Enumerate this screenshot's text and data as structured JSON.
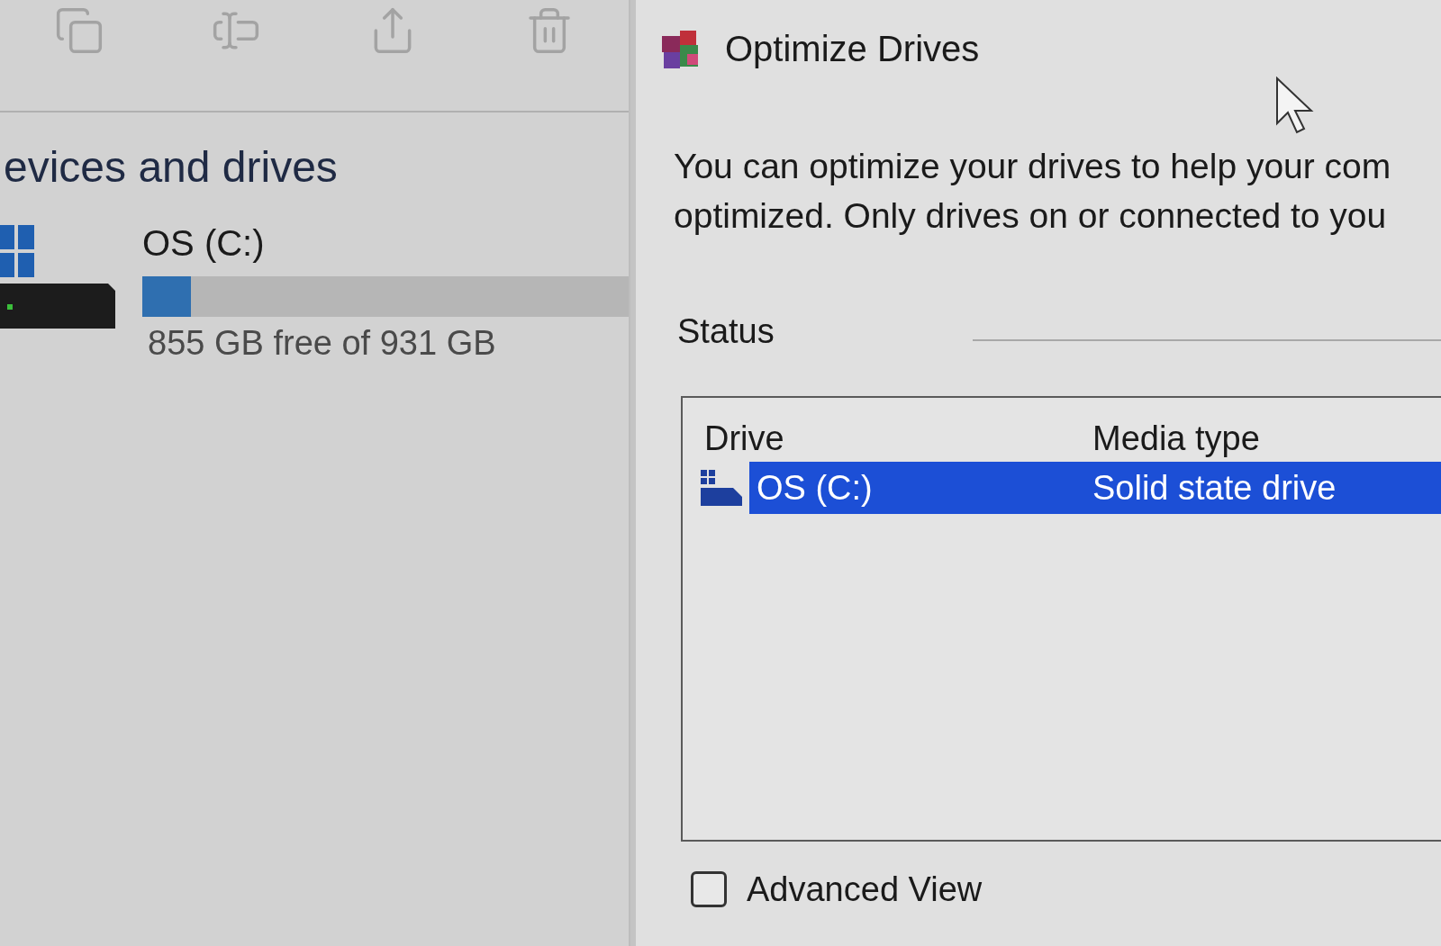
{
  "explorer": {
    "section_title": "evices and drives",
    "drives": [
      {
        "name": "OS (C:)",
        "level": 0.1,
        "free_text": "855 GB free of 931 GB"
      }
    ]
  },
  "dialog": {
    "title": "Optimize Drives",
    "description_lines": [
      "You can optimize your drives to help your com",
      "optimized. Only drives on or connected to you"
    ],
    "status_label": "Status",
    "list": {
      "columns": [
        "Drive",
        "Media type"
      ],
      "rows": [
        {
          "cells": [
            "OS (C:)",
            "Solid state drive"
          ],
          "selected": true
        }
      ]
    },
    "advanced_view": {
      "label": "Advanced View",
      "checked": false
    }
  }
}
